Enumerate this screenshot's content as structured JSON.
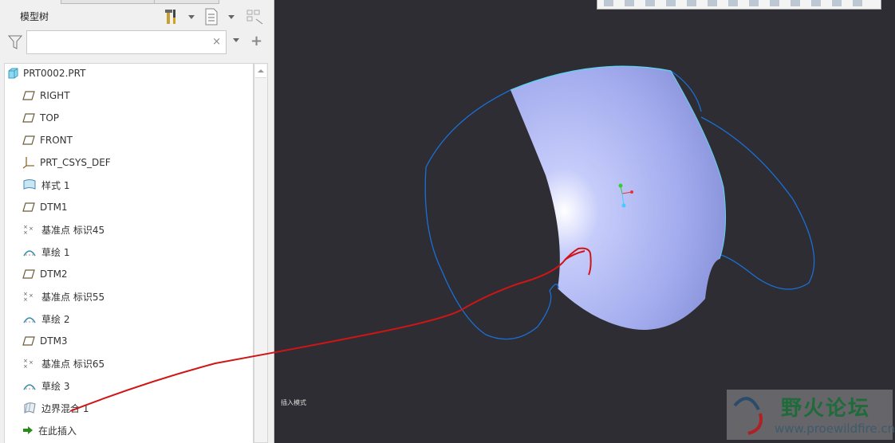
{
  "panel": {
    "title": "模型树",
    "search": {
      "value": "",
      "placeholder": ""
    },
    "clear_symbol": "×",
    "add_symbol": "+"
  },
  "tree": {
    "items": [
      {
        "label": "PRT0002.PRT",
        "icon": "part-icon"
      },
      {
        "label": "RIGHT",
        "icon": "datum-plane-icon"
      },
      {
        "label": "TOP",
        "icon": "datum-plane-icon"
      },
      {
        "label": "FRONT",
        "icon": "datum-plane-icon"
      },
      {
        "label": "PRT_CSYS_DEF",
        "icon": "csys-icon"
      },
      {
        "label": "样式 1",
        "icon": "style-icon"
      },
      {
        "label": "DTM1",
        "icon": "datum-plane-icon"
      },
      {
        "label": "基准点 标识45",
        "icon": "datum-point-icon"
      },
      {
        "label": "草绘 1",
        "icon": "sketch-icon"
      },
      {
        "label": "DTM2",
        "icon": "datum-plane-icon"
      },
      {
        "label": "基准点 标识55",
        "icon": "datum-point-icon"
      },
      {
        "label": "草绘 2",
        "icon": "sketch-icon"
      },
      {
        "label": "DTM3",
        "icon": "datum-plane-icon"
      },
      {
        "label": "基准点 标识65",
        "icon": "datum-point-icon"
      },
      {
        "label": "草绘 3",
        "icon": "sketch-icon"
      },
      {
        "label": "边界混合 1",
        "icon": "boundary-blend-icon"
      },
      {
        "label": "在此插入",
        "icon": "insert-here-arrow-icon"
      }
    ]
  },
  "viewport": {
    "mode_text": "插入模式",
    "background": "#2e2d33",
    "surface_color": "#a9b4f5",
    "curve_color": "#1a6fd6",
    "annotation_color": "#d01515"
  },
  "watermark": {
    "title": "野火论坛",
    "url": "www.proewildfire.cn"
  }
}
